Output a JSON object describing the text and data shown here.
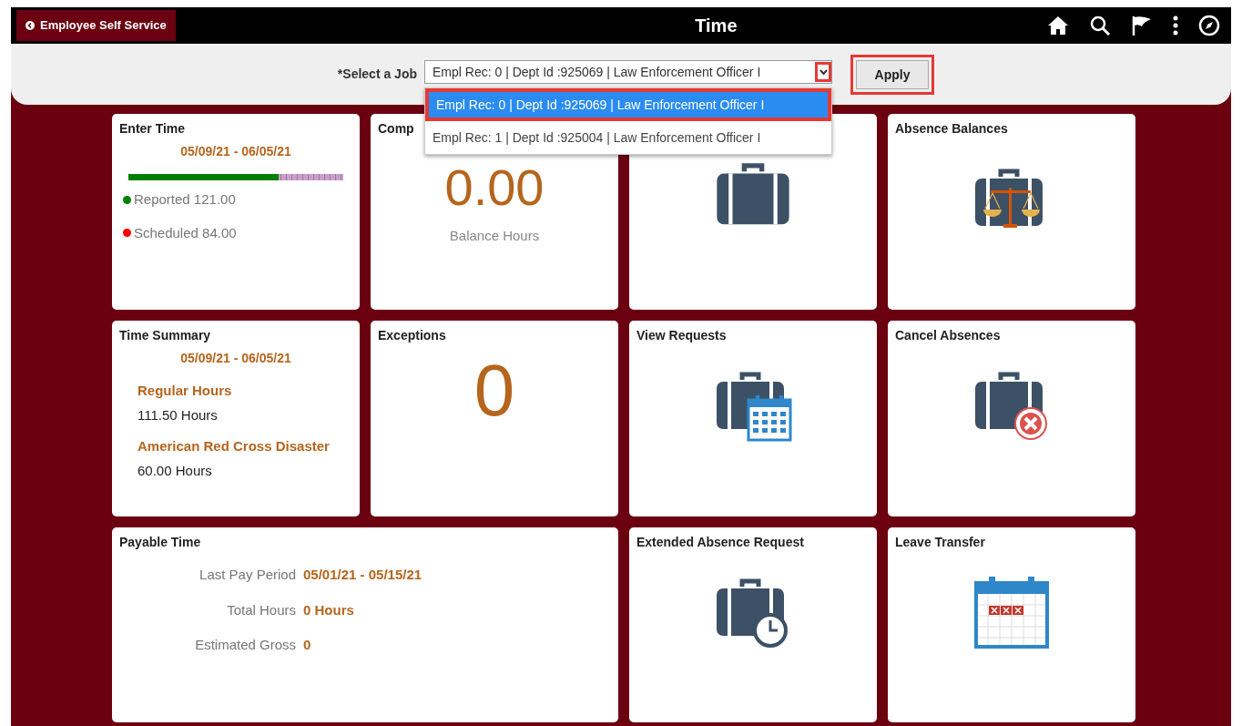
{
  "header": {
    "back_label": "Employee Self Service",
    "title": "Time"
  },
  "job_bar": {
    "label": "*Select a Job",
    "value": "Empl Rec: 0 | Dept Id :925069 | Law Enforcement Officer I",
    "caret_highlighted": true,
    "apply": "Apply",
    "apply_highlighted": true,
    "expanded": true,
    "options": [
      {
        "label": "Empl Rec: 0 | Dept Id :925069 | Law Enforcement Officer I",
        "selected": true,
        "highlighted": true
      },
      {
        "label": "Empl Rec: 1 | Dept Id :925004 | Law Enforcement Officer I",
        "selected": false,
        "highlighted": false
      }
    ]
  },
  "tiles": [
    {
      "kind": "enter_time",
      "title": "Enter Time",
      "period": "05/09/21 - 06/05/21",
      "level": 0.7,
      "legend": [
        {
          "label": "Reported 121.00",
          "color": "#008000"
        },
        {
          "label": "Scheduled 84.00",
          "color": "#ff0000"
        }
      ]
    },
    {
      "kind": "number",
      "title": "Comp",
      "value": "0.00",
      "caption": "Balance Hours"
    },
    {
      "kind": "briefcase"
    },
    {
      "kind": "scales",
      "title": "Absence Balances"
    },
    {
      "kind": "summary",
      "title": "Time Summary",
      "period": "05/09/21 - 06/05/21",
      "items": [
        {
          "label": "Regular Hours",
          "value": "111.50 Hours"
        },
        {
          "label": "American Red Cross Disaster",
          "value": "60.00 Hours"
        }
      ]
    },
    {
      "kind": "number",
      "title": "Exceptions",
      "value": "0"
    },
    {
      "kind": "calendar",
      "title": "View Requests"
    },
    {
      "kind": "cancel",
      "title": "Cancel Absences"
    },
    {
      "kind": "payable",
      "title": "Payable Time",
      "rows": [
        {
          "label": "Last Pay Period",
          "value": "05/01/21 - 05/15/21"
        },
        {
          "label": "Total Hours",
          "value": "0 Hours"
        },
        {
          "label": "Estimated Gross",
          "value": "0"
        }
      ]
    },
    {
      "kind": "clock",
      "title": "Extended Absence Request"
    },
    {
      "kind": "leave_calendar",
      "title": "Leave Transfer"
    }
  ]
}
